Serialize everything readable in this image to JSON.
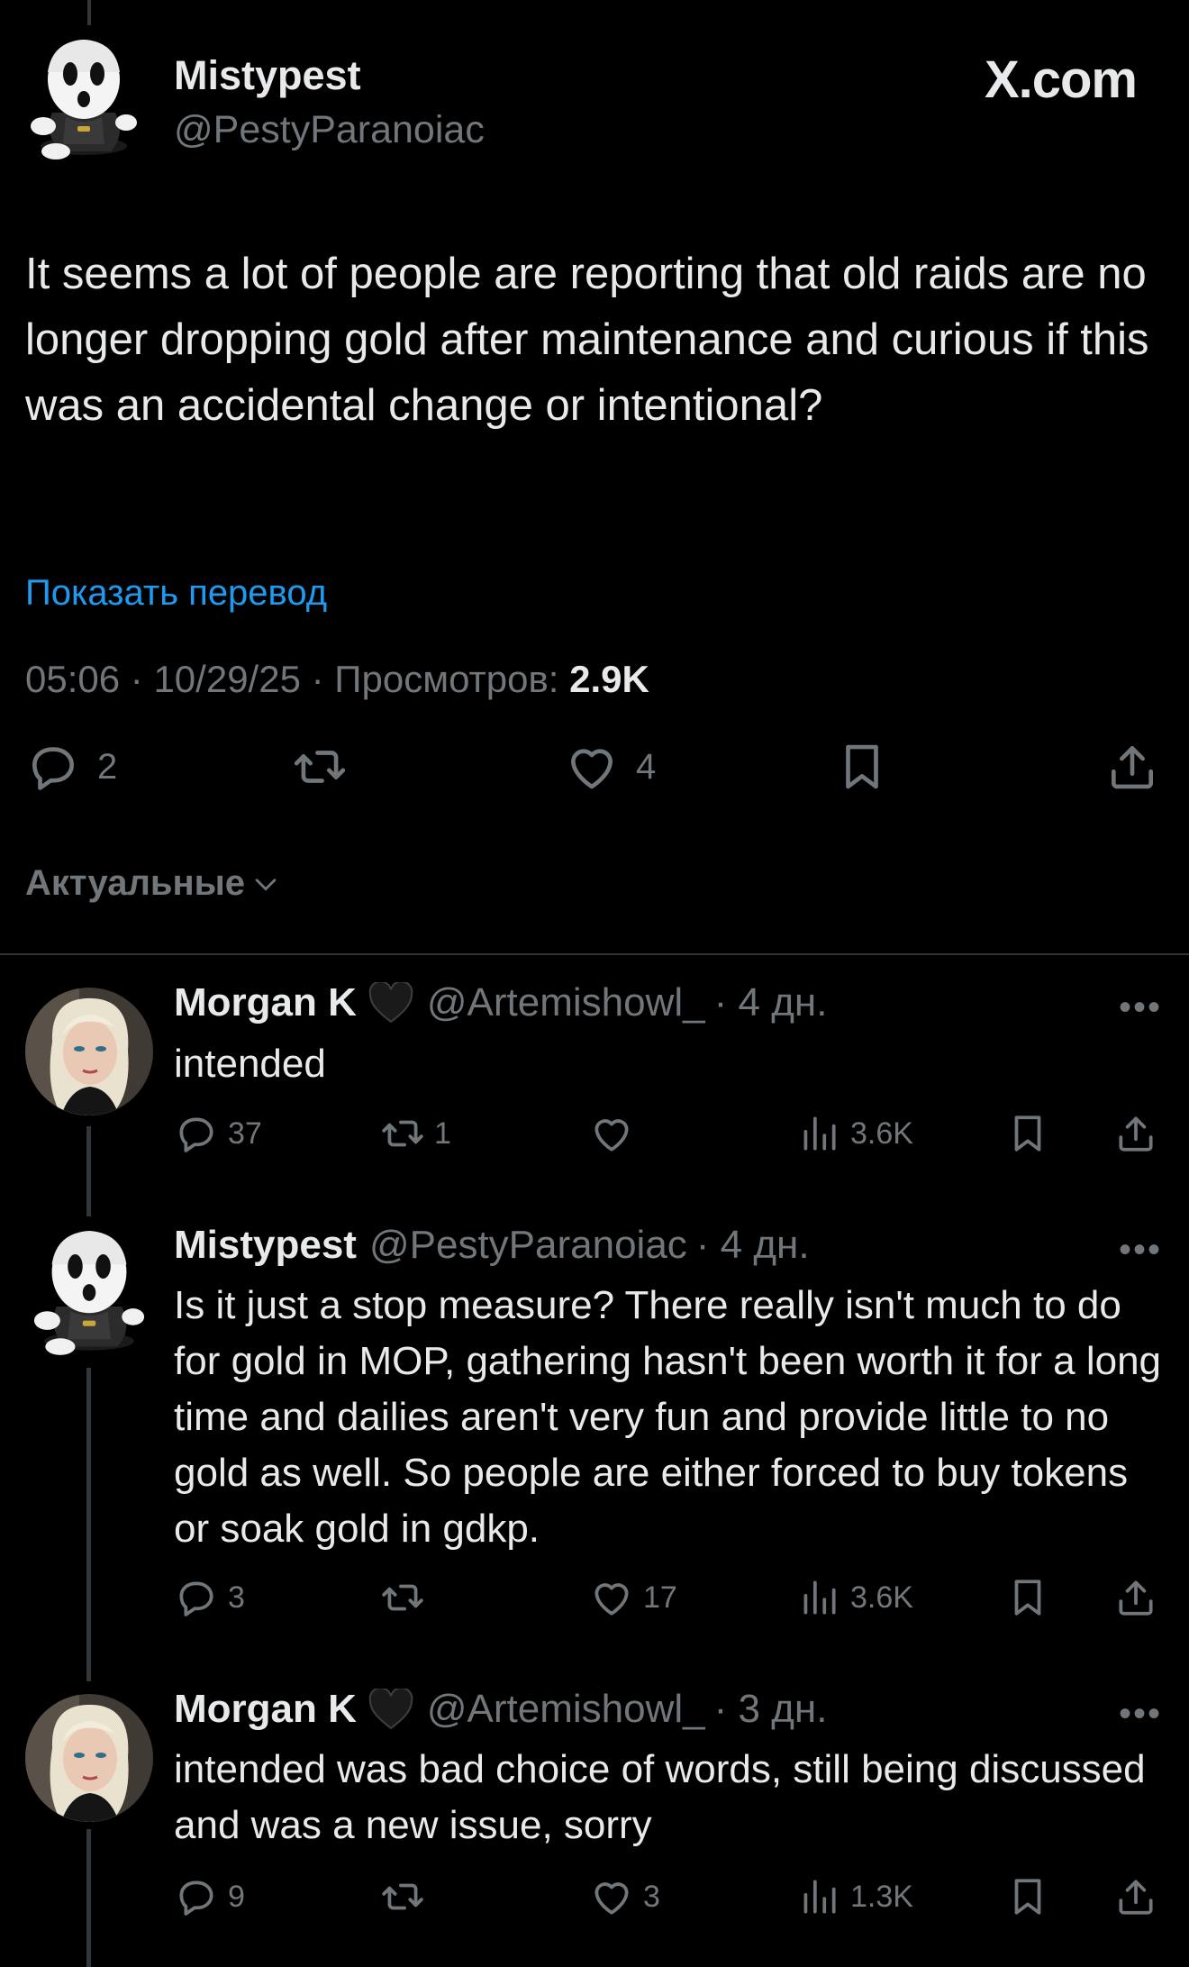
{
  "site_logo": "X.com",
  "main_post": {
    "author_name": "Mistypest",
    "author_handle": "@PestyParanoiac",
    "text": "It seems a lot of people are reporting that old raids are no longer dropping gold after maintenance and curious if this was an accidental change or intentional?",
    "translate_label": "Показать перевод",
    "time": "05:06",
    "date": "10/29/25",
    "views_label": "Просмотров:",
    "views_count": "2.9K",
    "replies": "2",
    "reposts": "",
    "likes": "4"
  },
  "sort": {
    "label": "Актуальные"
  },
  "replies": [
    {
      "author_name": "Morgan K",
      "author_handle": "@Artemishowl_",
      "time_ago": "· 4 дн.",
      "text": "intended",
      "replies": "37",
      "reposts": "1",
      "likes": "",
      "views": "3.6K"
    },
    {
      "author_name": "Mistypest",
      "author_handle": "@PestyParanoiac",
      "time_ago": "· 4 дн.",
      "text": "Is it just a stop measure? There really isn't much to do for gold in MOP, gathering hasn't been worth it for a long time and dailies aren't very fun and provide little to no gold as well. So people are either forced to buy tokens or soak gold in gdkp.",
      "replies": "3",
      "reposts": "",
      "likes": "17",
      "views": "3.6K"
    },
    {
      "author_name": "Morgan K",
      "author_handle": "@Artemishowl_",
      "time_ago": "· 3 дн.",
      "text": "intended was bad choice of words, still being discussed and was a new issue, sorry",
      "replies": "9",
      "reposts": "",
      "likes": "3",
      "views": "1.3K"
    }
  ],
  "more_label": "•••",
  "separator": "·",
  "colors": {
    "background": "#000000",
    "text": "#e7e9ea",
    "muted": "#71767b",
    "link": "#1d9bf0"
  }
}
